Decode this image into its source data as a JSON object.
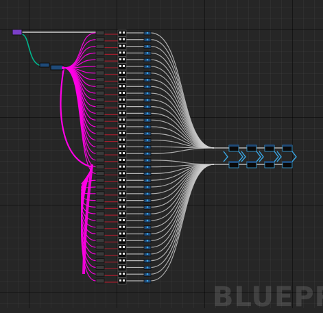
{
  "watermark": "BLUEPR",
  "colors": {
    "background": "#262626",
    "exec_wire": "#d0d0d0",
    "object_wire": "#00b48c",
    "array_wire": "#ff00e6",
    "int_wire": "#a01e2c",
    "node_header": "#1f4a78",
    "node_body": "#0a0a0a",
    "pin_blue": "#3aa8e6",
    "reroute_pin": "#7a3fc8"
  },
  "graph": {
    "row_count": 38,
    "collector_count": 4,
    "icons": {
      "get_node": "array-get-node-icon",
      "set_node": "set-node-icon",
      "reroute": "reroute-node-icon",
      "collector": "output-node-icon"
    }
  }
}
